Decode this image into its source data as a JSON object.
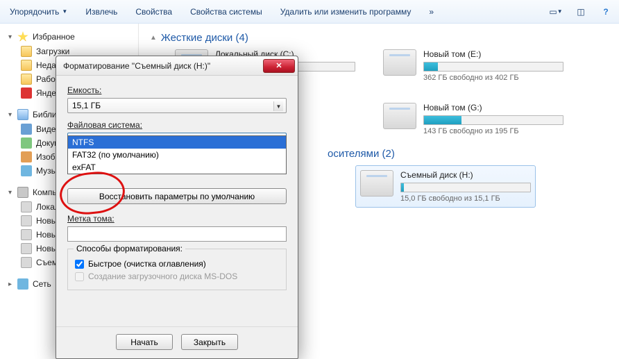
{
  "toolbar": {
    "organize": "Упорядочить",
    "extract": "Извлечь",
    "properties": "Свойства",
    "sysprops": "Свойства системы",
    "uninstall": "Удалить или изменить программу",
    "more": "»"
  },
  "sidebar": {
    "favorites": "Избранное",
    "downloads": "Загрузки",
    "recent": "Недав",
    "desktop": "Рабоч",
    "yandex": "Яндек",
    "libraries": "Библио",
    "videos": "Видео",
    "documents": "Докум",
    "images": "Изобр",
    "music": "Музы",
    "computer": "Компь",
    "local": "Локал",
    "newvol1": "Новы",
    "newvol2": "Новы",
    "newvol3": "Новы",
    "removable": "Съем",
    "network": "Сеть"
  },
  "groups": {
    "hdd_title": "Жесткие диски (4)",
    "removable_title": "осителями (2)"
  },
  "drives": [
    {
      "name": "Локальный диск (C:)",
      "sub": "",
      "fill": 0
    },
    {
      "name": "Новый том (E:)",
      "sub": "362 ГБ свободно из 402 ГБ",
      "fill": 10
    },
    {
      "name": "",
      "sub": "",
      "fill": 0
    },
    {
      "name": "Новый том (G:)",
      "sub": "143 ГБ свободно из 195 ГБ",
      "fill": 27
    }
  ],
  "removable": {
    "name": "Съемный диск (H:)",
    "sub": "15,0 ГБ свободно из 15,1 ГБ",
    "fill": 2
  },
  "dialog": {
    "title": "Форматирование \"Съемный диск (H:)\"",
    "capacity_label": "Емкость:",
    "capacity_value": "15,1 ГБ",
    "fs_label": "Файловая система:",
    "fs_value": "NTFS",
    "fs_options": [
      "NTFS",
      "FAT32 (по умолчанию)",
      "exFAT"
    ],
    "unit_label": "",
    "restore": "Восстановить параметры по умолчанию",
    "volume_label": "Метка тома:",
    "volume_value": "",
    "methods_legend": "Способы форматирования:",
    "quick": "Быстрое (очистка оглавления)",
    "msdos": "Создание загрузочного диска MS-DOS",
    "start": "Начать",
    "close": "Закрыть"
  }
}
